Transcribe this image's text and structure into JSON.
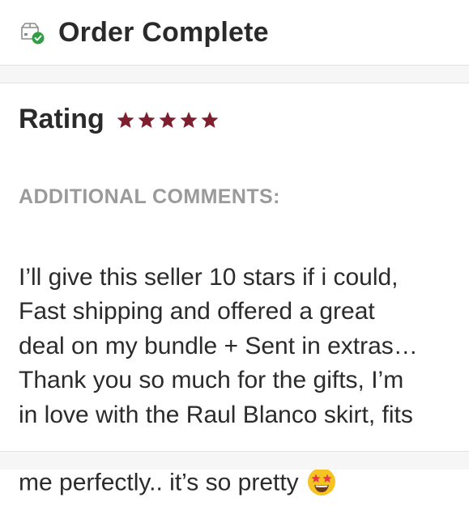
{
  "header": {
    "title": "Order Complete",
    "icon": "package-check-icon"
  },
  "rating": {
    "label": "Rating",
    "stars": 5,
    "max_stars": 5,
    "star_color": "#7d1f2e"
  },
  "comments": {
    "heading": "ADDITIONAL COMMENTS:",
    "text": "I’ll give this seller 10 stars if i could,\nFast shipping and offered a great\ndeal on my bundle + Sent in extras…\nThank you so much for the gifts, I’m\nin love with the Raul Blanco skirt, fits\nme perfectly.. it’s so pretty ",
    "emoji": "star-struck-emoji"
  },
  "colors": {
    "check_green": "#2f9e44",
    "heading_gray": "#9a9a9a"
  }
}
